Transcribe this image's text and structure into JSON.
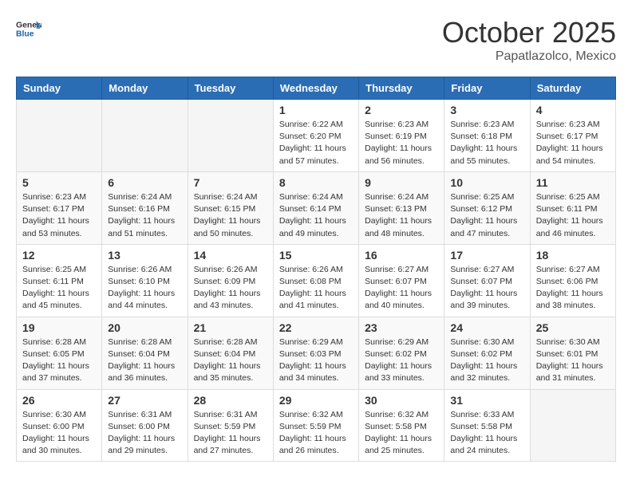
{
  "header": {
    "logo_line1": "General",
    "logo_line2": "Blue",
    "month": "October 2025",
    "location": "Papatlazolco, Mexico"
  },
  "weekdays": [
    "Sunday",
    "Monday",
    "Tuesday",
    "Wednesday",
    "Thursday",
    "Friday",
    "Saturday"
  ],
  "weeks": [
    [
      {
        "day": "",
        "info": ""
      },
      {
        "day": "",
        "info": ""
      },
      {
        "day": "",
        "info": ""
      },
      {
        "day": "1",
        "info": "Sunrise: 6:22 AM\nSunset: 6:20 PM\nDaylight: 11 hours\nand 57 minutes."
      },
      {
        "day": "2",
        "info": "Sunrise: 6:23 AM\nSunset: 6:19 PM\nDaylight: 11 hours\nand 56 minutes."
      },
      {
        "day": "3",
        "info": "Sunrise: 6:23 AM\nSunset: 6:18 PM\nDaylight: 11 hours\nand 55 minutes."
      },
      {
        "day": "4",
        "info": "Sunrise: 6:23 AM\nSunset: 6:17 PM\nDaylight: 11 hours\nand 54 minutes."
      }
    ],
    [
      {
        "day": "5",
        "info": "Sunrise: 6:23 AM\nSunset: 6:17 PM\nDaylight: 11 hours\nand 53 minutes."
      },
      {
        "day": "6",
        "info": "Sunrise: 6:24 AM\nSunset: 6:16 PM\nDaylight: 11 hours\nand 51 minutes."
      },
      {
        "day": "7",
        "info": "Sunrise: 6:24 AM\nSunset: 6:15 PM\nDaylight: 11 hours\nand 50 minutes."
      },
      {
        "day": "8",
        "info": "Sunrise: 6:24 AM\nSunset: 6:14 PM\nDaylight: 11 hours\nand 49 minutes."
      },
      {
        "day": "9",
        "info": "Sunrise: 6:24 AM\nSunset: 6:13 PM\nDaylight: 11 hours\nand 48 minutes."
      },
      {
        "day": "10",
        "info": "Sunrise: 6:25 AM\nSunset: 6:12 PM\nDaylight: 11 hours\nand 47 minutes."
      },
      {
        "day": "11",
        "info": "Sunrise: 6:25 AM\nSunset: 6:11 PM\nDaylight: 11 hours\nand 46 minutes."
      }
    ],
    [
      {
        "day": "12",
        "info": "Sunrise: 6:25 AM\nSunset: 6:11 PM\nDaylight: 11 hours\nand 45 minutes."
      },
      {
        "day": "13",
        "info": "Sunrise: 6:26 AM\nSunset: 6:10 PM\nDaylight: 11 hours\nand 44 minutes."
      },
      {
        "day": "14",
        "info": "Sunrise: 6:26 AM\nSunset: 6:09 PM\nDaylight: 11 hours\nand 43 minutes."
      },
      {
        "day": "15",
        "info": "Sunrise: 6:26 AM\nSunset: 6:08 PM\nDaylight: 11 hours\nand 41 minutes."
      },
      {
        "day": "16",
        "info": "Sunrise: 6:27 AM\nSunset: 6:07 PM\nDaylight: 11 hours\nand 40 minutes."
      },
      {
        "day": "17",
        "info": "Sunrise: 6:27 AM\nSunset: 6:07 PM\nDaylight: 11 hours\nand 39 minutes."
      },
      {
        "day": "18",
        "info": "Sunrise: 6:27 AM\nSunset: 6:06 PM\nDaylight: 11 hours\nand 38 minutes."
      }
    ],
    [
      {
        "day": "19",
        "info": "Sunrise: 6:28 AM\nSunset: 6:05 PM\nDaylight: 11 hours\nand 37 minutes."
      },
      {
        "day": "20",
        "info": "Sunrise: 6:28 AM\nSunset: 6:04 PM\nDaylight: 11 hours\nand 36 minutes."
      },
      {
        "day": "21",
        "info": "Sunrise: 6:28 AM\nSunset: 6:04 PM\nDaylight: 11 hours\nand 35 minutes."
      },
      {
        "day": "22",
        "info": "Sunrise: 6:29 AM\nSunset: 6:03 PM\nDaylight: 11 hours\nand 34 minutes."
      },
      {
        "day": "23",
        "info": "Sunrise: 6:29 AM\nSunset: 6:02 PM\nDaylight: 11 hours\nand 33 minutes."
      },
      {
        "day": "24",
        "info": "Sunrise: 6:30 AM\nSunset: 6:02 PM\nDaylight: 11 hours\nand 32 minutes."
      },
      {
        "day": "25",
        "info": "Sunrise: 6:30 AM\nSunset: 6:01 PM\nDaylight: 11 hours\nand 31 minutes."
      }
    ],
    [
      {
        "day": "26",
        "info": "Sunrise: 6:30 AM\nSunset: 6:00 PM\nDaylight: 11 hours\nand 30 minutes."
      },
      {
        "day": "27",
        "info": "Sunrise: 6:31 AM\nSunset: 6:00 PM\nDaylight: 11 hours\nand 29 minutes."
      },
      {
        "day": "28",
        "info": "Sunrise: 6:31 AM\nSunset: 5:59 PM\nDaylight: 11 hours\nand 27 minutes."
      },
      {
        "day": "29",
        "info": "Sunrise: 6:32 AM\nSunset: 5:59 PM\nDaylight: 11 hours\nand 26 minutes."
      },
      {
        "day": "30",
        "info": "Sunrise: 6:32 AM\nSunset: 5:58 PM\nDaylight: 11 hours\nand 25 minutes."
      },
      {
        "day": "31",
        "info": "Sunrise: 6:33 AM\nSunset: 5:58 PM\nDaylight: 11 hours\nand 24 minutes."
      },
      {
        "day": "",
        "info": ""
      }
    ]
  ]
}
